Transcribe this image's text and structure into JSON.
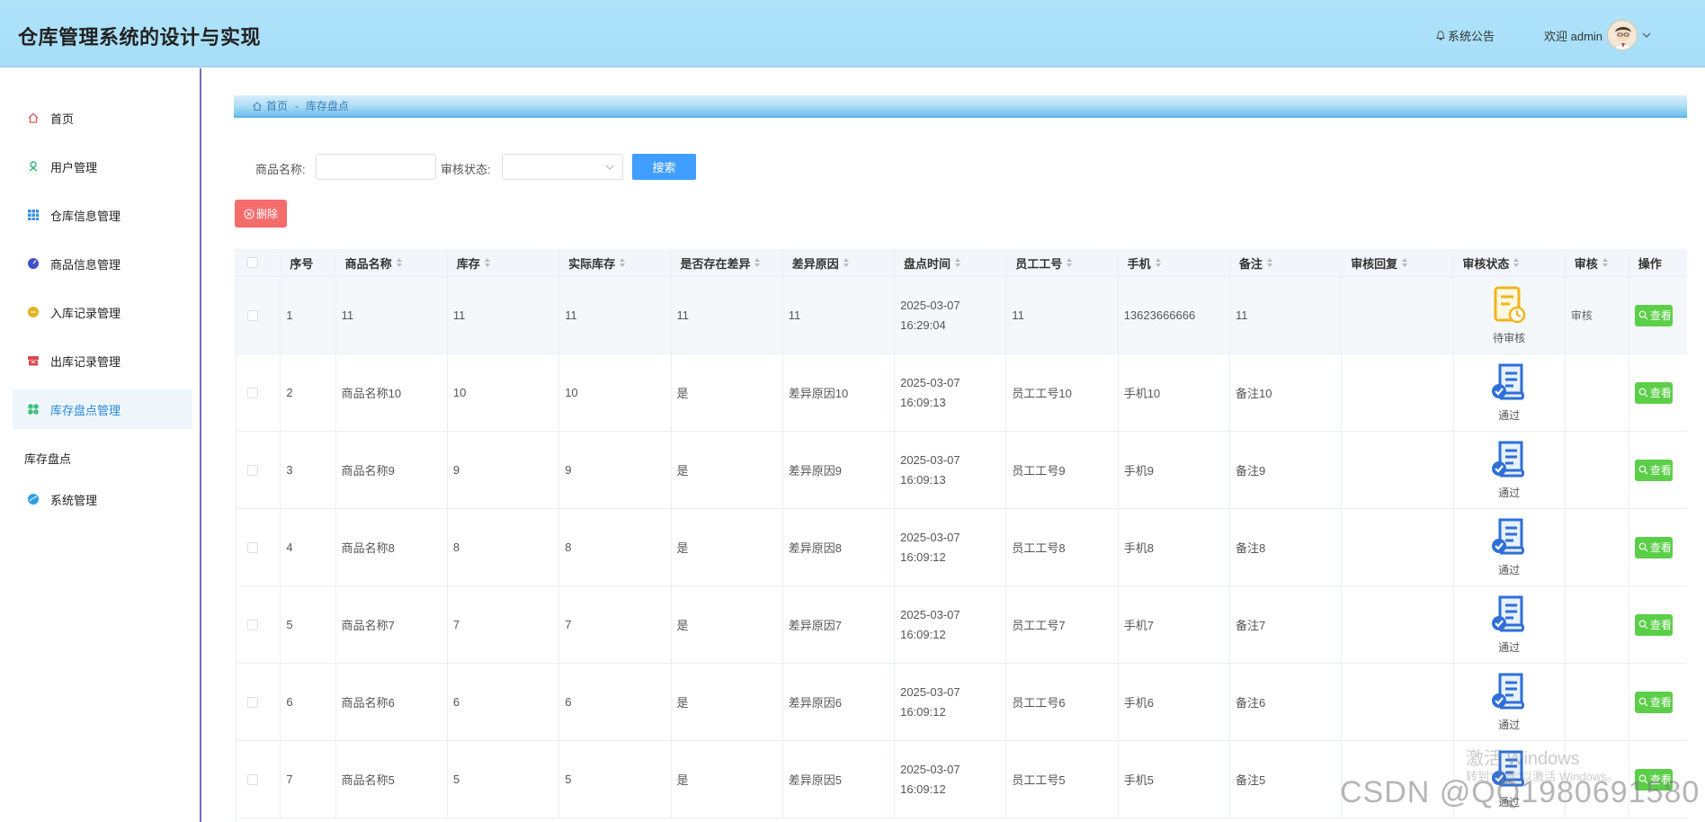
{
  "header": {
    "app_title": "仓库管理系统的设计与实现",
    "notice_label": "系统公告",
    "welcome_text": "欢迎 admin"
  },
  "sidebar": {
    "items": [
      {
        "label": "首页",
        "icon": "home-icon",
        "color": "#e05a5a"
      },
      {
        "label": "用户管理",
        "icon": "user-icon",
        "color": "#2db56a"
      },
      {
        "label": "仓库信息管理",
        "icon": "grid-icon",
        "color": "#3a8ee6"
      },
      {
        "label": "商品信息管理",
        "icon": "circle-icon",
        "color": "#3f51c6"
      },
      {
        "label": "入库记录管理",
        "icon": "circle-icon",
        "color": "#e3b21f"
      },
      {
        "label": "出库记录管理",
        "icon": "box-icon",
        "color": "#d94a52"
      },
      {
        "label": "库存盘点管理",
        "icon": "flower-icon",
        "color": "#3fc07a"
      }
    ],
    "sub_label": "库存盘点",
    "system_item": {
      "label": "系统管理",
      "icon": "circle-icon",
      "color": "#2e9fe4"
    }
  },
  "breadcrumb": {
    "home": "首页",
    "separator": "-",
    "current": "库存盘点"
  },
  "search": {
    "product_label": "商品名称:",
    "product_value": "",
    "status_label": "审核状态:",
    "status_value": "",
    "search_button": "搜索"
  },
  "actions": {
    "delete_button": "删除"
  },
  "table": {
    "columns": [
      "序号",
      "商品名称",
      "库存",
      "实际库存",
      "是否存在差异",
      "差异原因",
      "盘点时间",
      "员工工号",
      "手机",
      "备注",
      "审核回复",
      "审核状态",
      "审核",
      "操作"
    ],
    "rows": [
      {
        "index": "1",
        "name": "11",
        "stock": "11",
        "actual": "11",
        "diff": "11",
        "reason": "11",
        "time": "2025-03-07 16:29:04",
        "emp": "11",
        "phone": "13623666666",
        "note": "11",
        "reply": "",
        "status": "待审核",
        "audit": "审核",
        "op": "查看"
      },
      {
        "index": "2",
        "name": "商品名称10",
        "stock": "10",
        "actual": "10",
        "diff": "是",
        "reason": "差异原因10",
        "time": "2025-03-07 16:09:13",
        "emp": "员工工号10",
        "phone": "手机10",
        "note": "备注10",
        "reply": "",
        "status": "通过",
        "audit": "",
        "op": "查看"
      },
      {
        "index": "3",
        "name": "商品名称9",
        "stock": "9",
        "actual": "9",
        "diff": "是",
        "reason": "差异原因9",
        "time": "2025-03-07 16:09:13",
        "emp": "员工工号9",
        "phone": "手机9",
        "note": "备注9",
        "reply": "",
        "status": "通过",
        "audit": "",
        "op": "查看"
      },
      {
        "index": "4",
        "name": "商品名称8",
        "stock": "8",
        "actual": "8",
        "diff": "是",
        "reason": "差异原因8",
        "time": "2025-03-07 16:09:12",
        "emp": "员工工号8",
        "phone": "手机8",
        "note": "备注8",
        "reply": "",
        "status": "通过",
        "audit": "",
        "op": "查看"
      },
      {
        "index": "5",
        "name": "商品名称7",
        "stock": "7",
        "actual": "7",
        "diff": "是",
        "reason": "差异原因7",
        "time": "2025-03-07 16:09:12",
        "emp": "员工工号7",
        "phone": "手机7",
        "note": "备注7",
        "reply": "",
        "status": "通过",
        "audit": "",
        "op": "查看"
      },
      {
        "index": "6",
        "name": "商品名称6",
        "stock": "6",
        "actual": "6",
        "diff": "是",
        "reason": "差异原因6",
        "time": "2025-03-07 16:09:12",
        "emp": "员工工号6",
        "phone": "手机6",
        "note": "备注6",
        "reply": "",
        "status": "通过",
        "audit": "",
        "op": "查看"
      },
      {
        "index": "7",
        "name": "商品名称5",
        "stock": "5",
        "actual": "5",
        "diff": "是",
        "reason": "差异原因5",
        "time": "2025-03-07 16:09:12",
        "emp": "员工工号5",
        "phone": "手机5",
        "note": "备注5",
        "reply": "",
        "status": "通过",
        "audit": "",
        "op": "查看"
      }
    ]
  },
  "watermarks": {
    "activate_title": "激活 Windows",
    "activate_hint": "转到\"设置\"以激活 Windows。",
    "csdn": "CSDN @QQ1980691580"
  },
  "colors": {
    "header_bg": "#a7def8",
    "accent": "#409eff",
    "danger": "#f56c6c",
    "success": "#5ccf49",
    "active_menu": "#2a88d8"
  }
}
